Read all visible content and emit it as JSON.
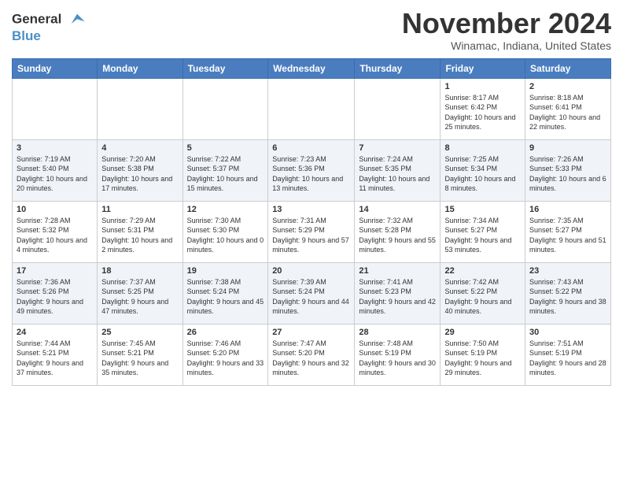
{
  "logo": {
    "line1": "General",
    "line2": "Blue"
  },
  "title": "November 2024",
  "location": "Winamac, Indiana, United States",
  "days_of_week": [
    "Sunday",
    "Monday",
    "Tuesday",
    "Wednesday",
    "Thursday",
    "Friday",
    "Saturday"
  ],
  "weeks": [
    [
      {
        "day": "",
        "info": ""
      },
      {
        "day": "",
        "info": ""
      },
      {
        "day": "",
        "info": ""
      },
      {
        "day": "",
        "info": ""
      },
      {
        "day": "",
        "info": ""
      },
      {
        "day": "1",
        "info": "Sunrise: 8:17 AM\nSunset: 6:42 PM\nDaylight: 10 hours and 25 minutes."
      },
      {
        "day": "2",
        "info": "Sunrise: 8:18 AM\nSunset: 6:41 PM\nDaylight: 10 hours and 22 minutes."
      }
    ],
    [
      {
        "day": "3",
        "info": "Sunrise: 7:19 AM\nSunset: 5:40 PM\nDaylight: 10 hours and 20 minutes."
      },
      {
        "day": "4",
        "info": "Sunrise: 7:20 AM\nSunset: 5:38 PM\nDaylight: 10 hours and 17 minutes."
      },
      {
        "day": "5",
        "info": "Sunrise: 7:22 AM\nSunset: 5:37 PM\nDaylight: 10 hours and 15 minutes."
      },
      {
        "day": "6",
        "info": "Sunrise: 7:23 AM\nSunset: 5:36 PM\nDaylight: 10 hours and 13 minutes."
      },
      {
        "day": "7",
        "info": "Sunrise: 7:24 AM\nSunset: 5:35 PM\nDaylight: 10 hours and 11 minutes."
      },
      {
        "day": "8",
        "info": "Sunrise: 7:25 AM\nSunset: 5:34 PM\nDaylight: 10 hours and 8 minutes."
      },
      {
        "day": "9",
        "info": "Sunrise: 7:26 AM\nSunset: 5:33 PM\nDaylight: 10 hours and 6 minutes."
      }
    ],
    [
      {
        "day": "10",
        "info": "Sunrise: 7:28 AM\nSunset: 5:32 PM\nDaylight: 10 hours and 4 minutes."
      },
      {
        "day": "11",
        "info": "Sunrise: 7:29 AM\nSunset: 5:31 PM\nDaylight: 10 hours and 2 minutes."
      },
      {
        "day": "12",
        "info": "Sunrise: 7:30 AM\nSunset: 5:30 PM\nDaylight: 10 hours and 0 minutes."
      },
      {
        "day": "13",
        "info": "Sunrise: 7:31 AM\nSunset: 5:29 PM\nDaylight: 9 hours and 57 minutes."
      },
      {
        "day": "14",
        "info": "Sunrise: 7:32 AM\nSunset: 5:28 PM\nDaylight: 9 hours and 55 minutes."
      },
      {
        "day": "15",
        "info": "Sunrise: 7:34 AM\nSunset: 5:27 PM\nDaylight: 9 hours and 53 minutes."
      },
      {
        "day": "16",
        "info": "Sunrise: 7:35 AM\nSunset: 5:27 PM\nDaylight: 9 hours and 51 minutes."
      }
    ],
    [
      {
        "day": "17",
        "info": "Sunrise: 7:36 AM\nSunset: 5:26 PM\nDaylight: 9 hours and 49 minutes."
      },
      {
        "day": "18",
        "info": "Sunrise: 7:37 AM\nSunset: 5:25 PM\nDaylight: 9 hours and 47 minutes."
      },
      {
        "day": "19",
        "info": "Sunrise: 7:38 AM\nSunset: 5:24 PM\nDaylight: 9 hours and 45 minutes."
      },
      {
        "day": "20",
        "info": "Sunrise: 7:39 AM\nSunset: 5:24 PM\nDaylight: 9 hours and 44 minutes."
      },
      {
        "day": "21",
        "info": "Sunrise: 7:41 AM\nSunset: 5:23 PM\nDaylight: 9 hours and 42 minutes."
      },
      {
        "day": "22",
        "info": "Sunrise: 7:42 AM\nSunset: 5:22 PM\nDaylight: 9 hours and 40 minutes."
      },
      {
        "day": "23",
        "info": "Sunrise: 7:43 AM\nSunset: 5:22 PM\nDaylight: 9 hours and 38 minutes."
      }
    ],
    [
      {
        "day": "24",
        "info": "Sunrise: 7:44 AM\nSunset: 5:21 PM\nDaylight: 9 hours and 37 minutes."
      },
      {
        "day": "25",
        "info": "Sunrise: 7:45 AM\nSunset: 5:21 PM\nDaylight: 9 hours and 35 minutes."
      },
      {
        "day": "26",
        "info": "Sunrise: 7:46 AM\nSunset: 5:20 PM\nDaylight: 9 hours and 33 minutes."
      },
      {
        "day": "27",
        "info": "Sunrise: 7:47 AM\nSunset: 5:20 PM\nDaylight: 9 hours and 32 minutes."
      },
      {
        "day": "28",
        "info": "Sunrise: 7:48 AM\nSunset: 5:19 PM\nDaylight: 9 hours and 30 minutes."
      },
      {
        "day": "29",
        "info": "Sunrise: 7:50 AM\nSunset: 5:19 PM\nDaylight: 9 hours and 29 minutes."
      },
      {
        "day": "30",
        "info": "Sunrise: 7:51 AM\nSunset: 5:19 PM\nDaylight: 9 hours and 28 minutes."
      }
    ]
  ]
}
